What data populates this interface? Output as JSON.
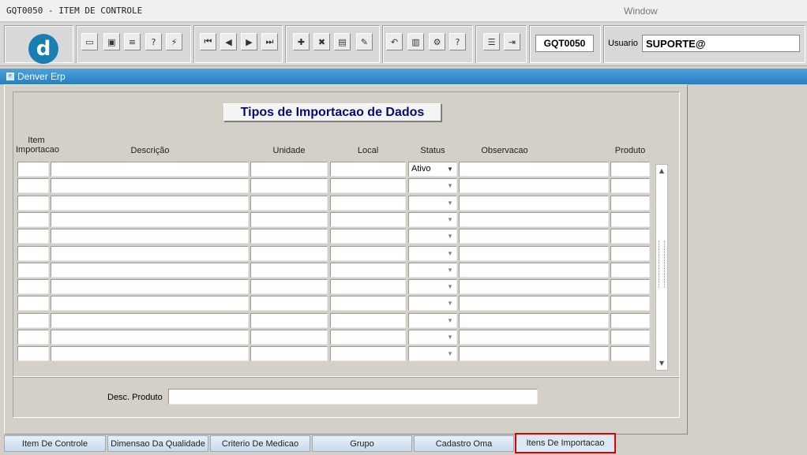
{
  "window": {
    "title": "GQT0050 - ITEM DE CONTROLE",
    "label": "Window"
  },
  "toolbar": {
    "logo_letter": "d",
    "buttons": [
      {
        "name": "save-icon",
        "glyph": "▭"
      },
      {
        "name": "screen-icon",
        "glyph": "▣"
      },
      {
        "name": "print-icon",
        "glyph": "≡"
      },
      {
        "name": "query-help-icon",
        "glyph": "?"
      },
      {
        "name": "query-run-icon",
        "glyph": "⚡"
      },
      {
        "name": "first-record-icon",
        "glyph": "⏮"
      },
      {
        "name": "previous-record-icon",
        "glyph": "◀"
      },
      {
        "name": "next-record-icon",
        "glyph": "▶"
      },
      {
        "name": "last-record-icon",
        "glyph": "⏭"
      },
      {
        "name": "insert-record-icon",
        "glyph": "✚"
      },
      {
        "name": "delete-record-icon",
        "glyph": "✖"
      },
      {
        "name": "list-icon",
        "glyph": "▤"
      },
      {
        "name": "edit-icon",
        "glyph": "✎"
      },
      {
        "name": "undo-icon",
        "glyph": "↶"
      },
      {
        "name": "clipboard-icon",
        "glyph": "▥"
      },
      {
        "name": "tools-icon",
        "glyph": "⚙"
      },
      {
        "name": "help-icon",
        "glyph": "?"
      },
      {
        "name": "menu-icon",
        "glyph": "☰"
      },
      {
        "name": "exit-icon",
        "glyph": "⇥"
      }
    ],
    "screen_code": "GQT0050",
    "user_label": "Usuario",
    "user_value": "SUPORTE@"
  },
  "app": {
    "title": "Denver Erp"
  },
  "form": {
    "heading": "Tipos de Importacao de Dados",
    "columns": {
      "item_line1": "Item",
      "item_line2": "Importacao",
      "descricao": "Descrição",
      "unidade": "Unidade",
      "local": "Local",
      "status": "Status",
      "observacao": "Observacao",
      "produto": "Produto"
    },
    "rows": [
      {
        "status": "Ativo"
      },
      {
        "status": ""
      },
      {
        "status": ""
      },
      {
        "status": ""
      },
      {
        "status": ""
      },
      {
        "status": ""
      },
      {
        "status": ""
      },
      {
        "status": ""
      },
      {
        "status": ""
      },
      {
        "status": ""
      },
      {
        "status": ""
      },
      {
        "status": ""
      }
    ],
    "desc_produto_label": "Desc. Produto",
    "desc_produto_value": ""
  },
  "tabs": [
    {
      "label": "Item De Controle",
      "active": false
    },
    {
      "label": "Dimensao Da Qualidade",
      "active": false
    },
    {
      "label": "Criterio De Medicao",
      "active": false
    },
    {
      "label": "Grupo",
      "active": false
    },
    {
      "label": "Cadastro Oma",
      "active": false
    },
    {
      "label": "Itens De Importacao",
      "active": true
    }
  ]
}
